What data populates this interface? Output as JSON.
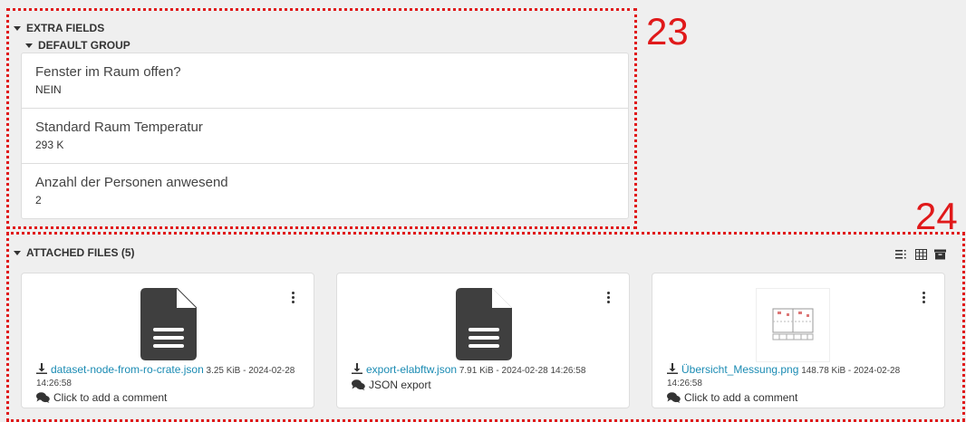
{
  "extra_fields": {
    "title": "EXTRA FIELDS",
    "group_title": "DEFAULT GROUP",
    "fields": [
      {
        "name": "Fenster im Raum offen?",
        "value": "NEIN"
      },
      {
        "name": "Standard Raum Temperatur",
        "value": "293 K"
      },
      {
        "name": "Anzahl der Personen anwesend",
        "value": "2"
      }
    ]
  },
  "attached_files": {
    "title": "ATTACHED FILES (5)",
    "files": [
      {
        "name": "dataset-node-from-ro-crate.json",
        "meta": "3.25 KiB - 2024-02-28 14:26:58",
        "comment": "Click to add a comment",
        "icon": "file-lines-icon"
      },
      {
        "name": "export-elabftw.json",
        "meta": "7.91 KiB - 2024-02-28 14:26:58",
        "comment": "JSON export",
        "icon": "file-lines-icon"
      },
      {
        "name": "Übersicht_Messung.png",
        "meta": "148.78 KiB - 2024-02-28 14:26:58",
        "comment": "Click to add a comment",
        "icon": "image-thumbnail"
      }
    ]
  },
  "annotations": {
    "label_23": "23",
    "label_24": "24"
  },
  "colors": {
    "annotation": "#e0191a",
    "link": "#1a8bb3",
    "icon_dark": "#3f3f3f"
  }
}
